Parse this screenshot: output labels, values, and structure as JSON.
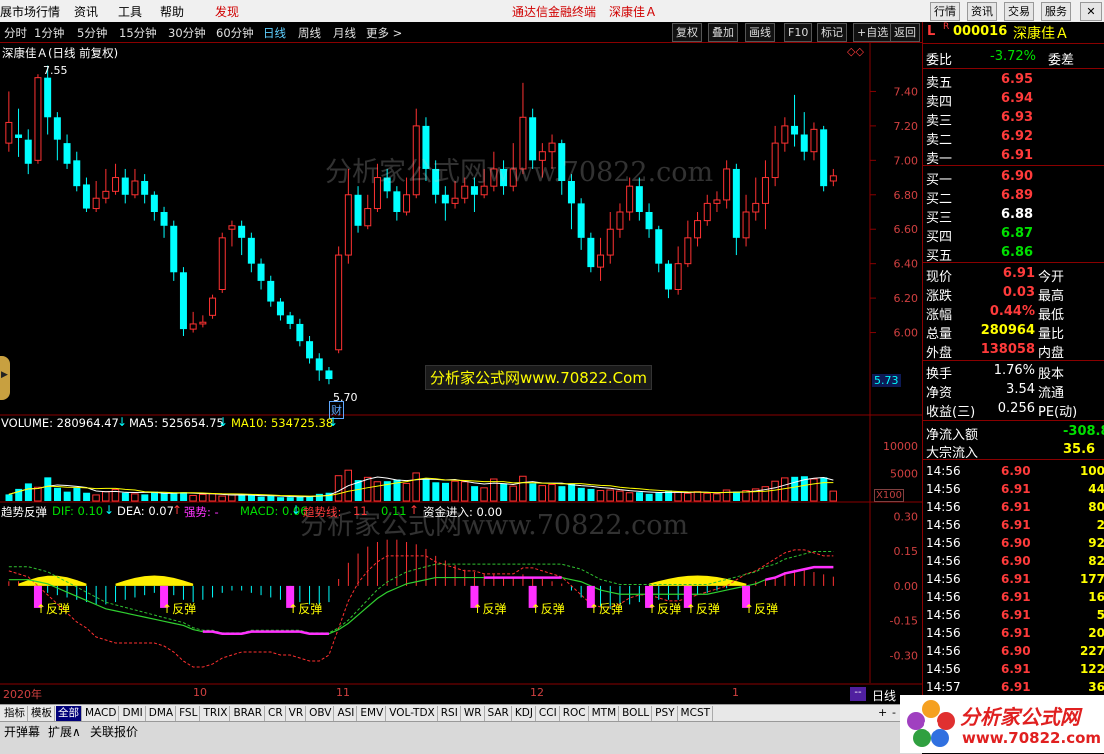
{
  "menu": {
    "items": [
      "展市场行情",
      "资讯",
      "工具",
      "帮助"
    ],
    "discover": "发现",
    "center_title": "通达信金融终端",
    "stock_title": "深康佳Ａ",
    "right_buttons": [
      "行情",
      "资讯",
      "交易",
      "服务"
    ]
  },
  "toolbar": {
    "periods": [
      "分时",
      "1分钟",
      "5分钟",
      "15分钟",
      "30分钟",
      "60分钟",
      "日线",
      "周线",
      "月线",
      "更多 >"
    ],
    "active_period": "日线",
    "buttons": [
      "复权",
      "叠加",
      "画线",
      "F10",
      "标记",
      "+自选",
      "返回"
    ]
  },
  "chart_header": {
    "title": "深康佳Ａ(日线 前复权)",
    "high_label": "7.55",
    "low_label": "5.70",
    "cai_mark": "财",
    "current_price_tag": "5.73",
    "watermark_banner": "分析家公式网www.70822.Com",
    "watermark_bg": "分析家公式网www.70822.com"
  },
  "volume_header": {
    "volume": "VOLUME: 280964.47",
    "ma5": "MA5: 525654.75",
    "ma10": "MA10: 534725.38",
    "unit_tag": "X100"
  },
  "indicator_header": {
    "name": "趋势反弹",
    "dif": "DIF: 0.10",
    "dea": "DEA: 0.07",
    "strong": "强势: -",
    "macd": "MACD: 0.06",
    "trend_line": "趋势线:",
    "v1": "11",
    "v2": "0.11",
    "fund": "资金进入: 0.00",
    "bounce_label": "反弹"
  },
  "date_axis": {
    "labels": [
      "2020年",
      "10",
      "11",
      "12",
      "1"
    ],
    "scroll_btn": "--"
  },
  "bottom_tabs": {
    "items": [
      "指标",
      "模板",
      "全部",
      "MACD",
      "DMI",
      "DMA",
      "FSL",
      "TRIX",
      "BRAR",
      "CR",
      "VR",
      "OBV",
      "ASI",
      "EMV",
      "VOL-TDX",
      "RSI",
      "WR",
      "SAR",
      "KDJ",
      "CCI",
      "ROC",
      "MTM",
      "BOLL",
      "PSY",
      "MCST"
    ],
    "active": "全部",
    "right_controls": [
      "+",
      "-",
      "日线"
    ]
  },
  "statusbar": {
    "items": [
      "开弹幕",
      "扩展∧",
      "关联报价"
    ]
  },
  "logo": {
    "name": "分析家公式网",
    "url": "www.70822.com"
  },
  "quote": {
    "flag": "L",
    "r_flag": "R",
    "code": "000016",
    "name": "深康佳Ａ",
    "weibi_label": "委比",
    "weibi_value": "-3.72%",
    "weicha_label": "委差",
    "asks": [
      {
        "label": "卖五",
        "price": "6.95"
      },
      {
        "label": "卖四",
        "price": "6.94"
      },
      {
        "label": "卖三",
        "price": "6.93"
      },
      {
        "label": "卖二",
        "price": "6.92"
      },
      {
        "label": "卖一",
        "price": "6.91"
      }
    ],
    "bids": [
      {
        "label": "买一",
        "price": "6.90",
        "color": "#ff3b3b"
      },
      {
        "label": "买二",
        "price": "6.89",
        "color": "#ff3b3b"
      },
      {
        "label": "买三",
        "price": "6.88",
        "color": "#ffffff"
      },
      {
        "label": "买四",
        "price": "6.87",
        "color": "#00e000"
      },
      {
        "label": "买五",
        "price": "6.86",
        "color": "#00e000"
      }
    ],
    "stats": [
      {
        "l": "现价",
        "v": "6.91",
        "c": "#ff3b3b",
        "r": "今开"
      },
      {
        "l": "涨跌",
        "v": "0.03",
        "c": "#ff3b3b",
        "r": "最高"
      },
      {
        "l": "涨幅",
        "v": "0.44%",
        "c": "#ff3b3b",
        "r": "最低"
      },
      {
        "l": "总量",
        "v": "280964",
        "c": "#ffff00",
        "r": "量比"
      },
      {
        "l": "外盘",
        "v": "138058",
        "c": "#ff3b3b",
        "r": "内盘"
      }
    ],
    "stats2": [
      {
        "l": "换手",
        "v": "1.76%",
        "c": "#ffffff",
        "r": "股本"
      },
      {
        "l": "净资",
        "v": "3.54",
        "c": "#ffffff",
        "r": "流通"
      },
      {
        "l": "收益(三)",
        "v": "0.256",
        "c": "#ffffff",
        "r": "PE(动)"
      }
    ],
    "flow": [
      {
        "l": "净流入额",
        "v": "-308.8",
        "c": "#00e000"
      },
      {
        "l": "大宗流入",
        "v": "35.6",
        "c": "#ffff00"
      }
    ],
    "ticks": [
      {
        "t": "14:56",
        "p": "6.90",
        "pc": "#ff3b3b",
        "v": "100",
        "vc": "#ffff00"
      },
      {
        "t": "14:56",
        "p": "6.91",
        "pc": "#ff3b3b",
        "v": "44",
        "vc": "#ffff00"
      },
      {
        "t": "14:56",
        "p": "6.91",
        "pc": "#ff3b3b",
        "v": "80",
        "vc": "#ffff00"
      },
      {
        "t": "14:56",
        "p": "6.91",
        "pc": "#ff3b3b",
        "v": "2",
        "vc": "#ffff00"
      },
      {
        "t": "14:56",
        "p": "6.90",
        "pc": "#ff3b3b",
        "v": "92",
        "vc": "#ffff00"
      },
      {
        "t": "14:56",
        "p": "6.90",
        "pc": "#ff3b3b",
        "v": "82",
        "vc": "#ffff00"
      },
      {
        "t": "14:56",
        "p": "6.91",
        "pc": "#ff3b3b",
        "v": "177",
        "vc": "#ffff00"
      },
      {
        "t": "14:56",
        "p": "6.91",
        "pc": "#ff3b3b",
        "v": "16",
        "vc": "#ffff00"
      },
      {
        "t": "14:56",
        "p": "6.91",
        "pc": "#ff3b3b",
        "v": "5",
        "vc": "#ffff00"
      },
      {
        "t": "14:56",
        "p": "6.91",
        "pc": "#ff3b3b",
        "v": "20",
        "vc": "#ffff00"
      },
      {
        "t": "14:56",
        "p": "6.90",
        "pc": "#ff3b3b",
        "v": "227",
        "vc": "#ffff00"
      },
      {
        "t": "14:56",
        "p": "6.91",
        "pc": "#ff3b3b",
        "v": "122",
        "vc": "#ffff00"
      },
      {
        "t": "14:57",
        "p": "6.91",
        "pc": "#ff3b3b",
        "v": "36",
        "vc": "#ffff00"
      }
    ]
  },
  "chart_data": [
    {
      "type": "candlestick",
      "price_axis": [
        7.4,
        7.2,
        7.0,
        6.8,
        6.6,
        6.4,
        6.2,
        6.0
      ],
      "ylim": [
        5.62,
        7.6
      ],
      "up_color": "#ff3232",
      "down_color": "#00ffff",
      "candles": [
        [
          7.1,
          7.22,
          7.4,
          7.05
        ],
        [
          7.15,
          7.13,
          7.3,
          7.02
        ],
        [
          7.12,
          6.98,
          7.18,
          6.92
        ],
        [
          7.0,
          7.48,
          7.5,
          6.98
        ],
        [
          7.48,
          7.25,
          7.55,
          7.15
        ],
        [
          7.25,
          7.12,
          7.28,
          7.0
        ],
        [
          7.1,
          6.98,
          7.15,
          6.95
        ],
        [
          7.0,
          6.85,
          7.05,
          6.82
        ],
        [
          6.86,
          6.72,
          6.9,
          6.7
        ],
        [
          6.72,
          6.78,
          6.88,
          6.7
        ],
        [
          6.78,
          6.82,
          6.95,
          6.75
        ],
        [
          6.82,
          6.9,
          6.98,
          6.8
        ],
        [
          6.9,
          6.8,
          6.95,
          6.75
        ],
        [
          6.8,
          6.88,
          6.95,
          6.78
        ],
        [
          6.88,
          6.8,
          6.92,
          6.75
        ],
        [
          6.8,
          6.7,
          6.82,
          6.65
        ],
        [
          6.7,
          6.62,
          6.73,
          6.55
        ],
        [
          6.62,
          6.35,
          6.65,
          6.3
        ],
        [
          6.35,
          6.02,
          6.38,
          5.98
        ],
        [
          6.02,
          6.05,
          6.12,
          6.0
        ],
        [
          6.05,
          6.06,
          6.1,
          6.03
        ],
        [
          6.1,
          6.2,
          6.22,
          6.08
        ],
        [
          6.25,
          6.55,
          6.58,
          6.23
        ],
        [
          6.6,
          6.62,
          6.65,
          6.5
        ],
        [
          6.62,
          6.55,
          6.65,
          6.45
        ],
        [
          6.55,
          6.4,
          6.58,
          6.35
        ],
        [
          6.4,
          6.3,
          6.43,
          6.25
        ],
        [
          6.3,
          6.18,
          6.33,
          6.15
        ],
        [
          6.18,
          6.1,
          6.2,
          6.07
        ],
        [
          6.1,
          6.05,
          6.12,
          6.02
        ],
        [
          6.05,
          5.95,
          6.08,
          5.92
        ],
        [
          5.95,
          5.85,
          5.98,
          5.82
        ],
        [
          5.85,
          5.78,
          5.88,
          5.72
        ],
        [
          5.78,
          5.73,
          5.8,
          5.7
        ],
        [
          5.9,
          6.45,
          6.5,
          5.88
        ],
        [
          6.45,
          6.8,
          6.95,
          6.4
        ],
        [
          6.8,
          6.62,
          6.85,
          6.58
        ],
        [
          6.62,
          6.72,
          6.8,
          6.6
        ],
        [
          6.72,
          6.9,
          6.98,
          6.7
        ],
        [
          6.9,
          6.82,
          6.95,
          6.78
        ],
        [
          6.82,
          6.7,
          6.85,
          6.65
        ],
        [
          6.7,
          6.8,
          6.9,
          6.68
        ],
        [
          6.8,
          7.2,
          7.3,
          6.78
        ],
        [
          7.2,
          6.95,
          7.25,
          6.88
        ],
        [
          6.95,
          6.8,
          7.0,
          6.75
        ],
        [
          6.8,
          6.75,
          6.85,
          6.65
        ],
        [
          6.75,
          6.78,
          6.88,
          6.72
        ],
        [
          6.78,
          6.85,
          6.9,
          6.75
        ],
        [
          6.85,
          6.8,
          6.9,
          6.7
        ],
        [
          6.8,
          6.85,
          6.95,
          6.78
        ],
        [
          6.85,
          6.95,
          7.05,
          6.82
        ],
        [
          6.95,
          6.85,
          7.0,
          6.8
        ],
        [
          6.85,
          6.95,
          7.1,
          6.82
        ],
        [
          6.95,
          7.25,
          7.45,
          6.92
        ],
        [
          7.25,
          7.0,
          7.3,
          6.95
        ],
        [
          7.0,
          7.05,
          7.1,
          6.9
        ],
        [
          7.05,
          7.1,
          7.15,
          6.95
        ],
        [
          7.1,
          6.88,
          7.12,
          6.8
        ],
        [
          6.88,
          6.75,
          6.92,
          6.6
        ],
        [
          6.75,
          6.55,
          6.78,
          6.48
        ],
        [
          6.55,
          6.38,
          6.58,
          6.35
        ],
        [
          6.38,
          6.45,
          6.55,
          6.3
        ],
        [
          6.45,
          6.6,
          6.7,
          6.4
        ],
        [
          6.6,
          6.7,
          6.75,
          6.55
        ],
        [
          6.7,
          6.85,
          6.9,
          6.65
        ],
        [
          6.85,
          6.7,
          6.9,
          6.65
        ],
        [
          6.7,
          6.6,
          6.75,
          6.55
        ],
        [
          6.6,
          6.4,
          6.62,
          6.35
        ],
        [
          6.4,
          6.25,
          6.42,
          6.2
        ],
        [
          6.25,
          6.4,
          6.5,
          6.22
        ],
        [
          6.4,
          6.55,
          6.65,
          6.38
        ],
        [
          6.55,
          6.65,
          6.7,
          6.5
        ],
        [
          6.65,
          6.75,
          6.8,
          6.62
        ],
        [
          6.75,
          6.77,
          6.82,
          6.7
        ],
        [
          6.77,
          6.95,
          7.0,
          6.72
        ],
        [
          6.95,
          6.55,
          6.98,
          6.45
        ],
        [
          6.55,
          6.7,
          6.8,
          6.5
        ],
        [
          6.7,
          6.75,
          6.9,
          6.65
        ],
        [
          6.75,
          6.9,
          7.0,
          6.6
        ],
        [
          6.9,
          7.1,
          7.2,
          6.85
        ],
        [
          7.1,
          7.2,
          7.25,
          7.05
        ],
        [
          7.2,
          7.15,
          7.38,
          7.08
        ],
        [
          7.15,
          7.05,
          7.28,
          7.0
        ],
        [
          7.05,
          7.18,
          7.22,
          7.0
        ],
        [
          7.18,
          6.85,
          7.2,
          6.82
        ],
        [
          6.88,
          6.91,
          6.95,
          6.85
        ]
      ]
    },
    {
      "type": "bar",
      "name": "VOLUME",
      "ticks": [
        10000,
        5000
      ],
      "ylim": [
        0,
        12000
      ],
      "values": [
        1200,
        2200,
        3200,
        2500,
        4300,
        2400,
        1700,
        2400,
        1500,
        1100,
        1700,
        2100,
        1500,
        1300,
        1200,
        1700,
        1400,
        1500,
        1600,
        1000,
        1200,
        1300,
        900,
        1100,
        1100,
        1000,
        800,
        900,
        700,
        700,
        800,
        900,
        1300,
        1500,
        4600,
        5600,
        3800,
        4300,
        3500,
        3600,
        3900,
        3200,
        5100,
        4100,
        3400,
        3300,
        3600,
        3500,
        2700,
        2400,
        4000,
        3200,
        2700,
        4500,
        3200,
        2800,
        3000,
        2700,
        3100,
        2400,
        2200,
        1900,
        2000,
        1800,
        1500,
        1600,
        1300,
        1500,
        1900,
        1600,
        1400,
        1700,
        1400,
        1300,
        2000,
        1700,
        1900,
        2200,
        2600,
        3600,
        4200,
        4400,
        4500,
        4000,
        4300,
        1800
      ],
      "up": [
        0,
        0,
        0,
        1,
        0,
        0,
        0,
        0,
        0,
        1,
        1,
        1,
        0,
        1,
        0,
        0,
        0,
        0,
        0,
        1,
        1,
        1,
        1,
        1,
        0,
        0,
        0,
        0,
        0,
        0,
        0,
        0,
        0,
        0,
        1,
        1,
        0,
        1,
        1,
        0,
        0,
        1,
        1,
        0,
        0,
        0,
        1,
        1,
        0,
        1,
        1,
        0,
        1,
        1,
        0,
        1,
        1,
        0,
        0,
        0,
        0,
        1,
        1,
        1,
        1,
        0,
        0,
        0,
        0,
        1,
        1,
        1,
        1,
        1,
        1,
        0,
        1,
        1,
        1,
        1,
        1,
        0,
        0,
        1,
        0,
        1
      ]
    },
    {
      "type": "line+bar",
      "name": "趋势反弹",
      "ticks": [
        0.3,
        0.15,
        0.0,
        -0.15,
        -0.3
      ],
      "ylim": [
        -0.42,
        0.35
      ],
      "macd_hist": [
        0.02,
        0.02,
        0.01,
        -0.02,
        -0.03,
        -0.04,
        -0.05,
        -0.06,
        -0.07,
        -0.08,
        -0.08,
        -0.07,
        -0.06,
        -0.05,
        -0.04,
        -0.03,
        -0.03,
        -0.04,
        -0.06,
        -0.07,
        -0.06,
        -0.05,
        -0.03,
        -0.02,
        -0.02,
        -0.03,
        -0.04,
        -0.05,
        -0.06,
        -0.06,
        -0.07,
        -0.08,
        -0.08,
        -0.07,
        0.03,
        0.1,
        0.14,
        0.17,
        0.19,
        0.2,
        0.2,
        0.19,
        0.18,
        0.16,
        0.13,
        0.11,
        0.09,
        0.07,
        0.06,
        0.05,
        0.05,
        0.04,
        0.04,
        0.05,
        0.04,
        0.03,
        0.02,
        0.01,
        -0.02,
        -0.05,
        -0.07,
        -0.09,
        -0.1,
        -0.09,
        -0.08,
        -0.07,
        -0.06,
        -0.06,
        -0.06,
        -0.06,
        -0.05,
        -0.04,
        -0.03,
        -0.02,
        -0.01,
        0.0,
        0.01,
        0.02,
        0.03,
        0.04,
        0.06,
        0.07,
        0.07,
        0.06,
        0.05,
        0.04
      ],
      "dif": [
        0.05,
        0.04,
        0.03,
        0.0,
        -0.03,
        -0.06,
        -0.09,
        -0.12,
        -0.14,
        -0.17,
        -0.18,
        -0.19,
        -0.19,
        -0.19,
        -0.19,
        -0.19,
        -0.2,
        -0.22,
        -0.25,
        -0.27,
        -0.27,
        -0.26,
        -0.24,
        -0.23,
        -0.22,
        -0.22,
        -0.22,
        -0.22,
        -0.23,
        -0.23,
        -0.24,
        -0.25,
        -0.25,
        -0.23,
        -0.14,
        -0.05,
        0.01,
        0.05,
        0.08,
        0.1,
        0.1,
        0.1,
        0.1,
        0.1,
        0.08,
        0.07,
        0.06,
        0.05,
        0.05,
        0.04,
        0.04,
        0.04,
        0.04,
        0.06,
        0.06,
        0.05,
        0.04,
        0.03,
        0.0,
        -0.03,
        -0.06,
        -0.07,
        -0.07,
        -0.06,
        -0.04,
        -0.03,
        -0.03,
        -0.04,
        -0.05,
        -0.05,
        -0.04,
        -0.03,
        -0.02,
        -0.01,
        0.0,
        0.02,
        0.04,
        0.05,
        0.07,
        0.09,
        0.11,
        0.12,
        0.12,
        0.11,
        0.1,
        0.1
      ],
      "dea": [
        0.03,
        0.03,
        0.03,
        0.02,
        0.01,
        -0.01,
        -0.03,
        -0.05,
        -0.07,
        -0.09,
        -0.11,
        -0.12,
        -0.13,
        -0.14,
        -0.15,
        -0.16,
        -0.17,
        -0.18,
        -0.19,
        -0.21,
        -0.22,
        -0.22,
        -0.23,
        -0.23,
        -0.23,
        -0.22,
        -0.22,
        -0.22,
        -0.22,
        -0.22,
        -0.22,
        -0.23,
        -0.23,
        -0.23,
        -0.21,
        -0.18,
        -0.14,
        -0.1,
        -0.06,
        -0.03,
        -0.01,
        0.01,
        0.02,
        0.03,
        0.04,
        0.04,
        0.04,
        0.04,
        0.04,
        0.04,
        0.04,
        0.04,
        0.04,
        0.04,
        0.04,
        0.04,
        0.04,
        0.04,
        0.03,
        0.02,
        0.0,
        -0.02,
        -0.03,
        -0.04,
        -0.04,
        -0.04,
        -0.04,
        -0.04,
        -0.04,
        -0.04,
        -0.04,
        -0.04,
        -0.04,
        -0.03,
        -0.02,
        -0.01,
        0.0,
        0.01,
        0.03,
        0.04,
        0.06,
        0.07,
        0.08,
        0.09,
        0.09,
        0.09
      ],
      "signal_days": [
        3,
        16,
        29,
        48,
        54,
        60,
        66,
        70,
        76
      ]
    }
  ]
}
